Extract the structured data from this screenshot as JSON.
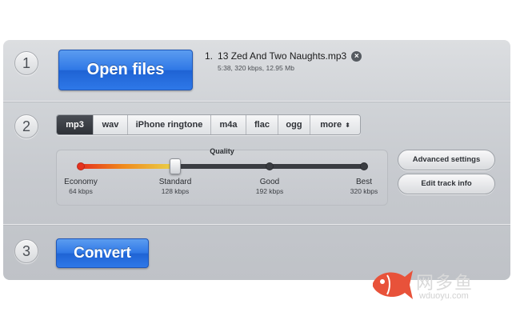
{
  "steps": {
    "one": "1",
    "two": "2",
    "three": "3"
  },
  "open_button": "Open files",
  "file": {
    "number": "1.",
    "name": "13 Zed And Two Naughts.mp3",
    "meta": "5:38, 320 kbps, 12.95 Mb",
    "remove_icon": "close-circle-icon"
  },
  "formats": [
    {
      "label": "mp3",
      "active": true
    },
    {
      "label": "wav",
      "active": false
    },
    {
      "label": "iPhone ringtone",
      "active": false
    },
    {
      "label": "m4a",
      "active": false
    },
    {
      "label": "flac",
      "active": false
    },
    {
      "label": "ogg",
      "active": false
    },
    {
      "label": "more",
      "active": false,
      "caret": "⬍"
    }
  ],
  "quality": {
    "title": "Quality",
    "levels": [
      {
        "name": "Economy",
        "kbps": "64 kbps"
      },
      {
        "name": "Standard",
        "kbps": "128 kbps"
      },
      {
        "name": "Good",
        "kbps": "192 kbps"
      },
      {
        "name": "Best",
        "kbps": "320 kbps"
      }
    ],
    "selected_index": 1,
    "colors": {
      "low": "#e5321e",
      "mid": "#f08a1c",
      "high": "#e9d34a",
      "track": "#3a3d42"
    }
  },
  "side_buttons": {
    "advanced": "Advanced settings",
    "edit": "Edit track info"
  },
  "convert_button": "Convert",
  "watermark": {
    "cn": "网多鱼",
    "en": "wduoyu.com",
    "icon": "fish-logo-icon",
    "color": "#e8523a"
  },
  "colors": {
    "accent_blue": "#2f78e6",
    "panel_bg": "#c6c9ce",
    "active_tab": "#2e3137"
  }
}
